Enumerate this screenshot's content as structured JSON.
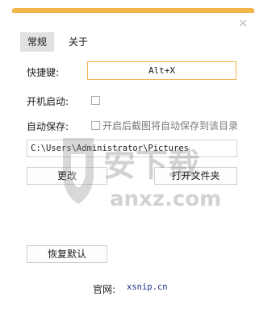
{
  "window": {
    "close_glyph": "×"
  },
  "tabs": {
    "general": "常规",
    "about": "关于"
  },
  "hotkey": {
    "label": "快捷键:",
    "value": "Alt+X"
  },
  "autostart": {
    "label": "开机启动:"
  },
  "autosave": {
    "label": "自动保存:",
    "option_label": "开启后截图将自动保存到该目录"
  },
  "save_path": {
    "value": "C:\\Users\\Administrator\\Pictures"
  },
  "buttons": {
    "change": "更改",
    "open_folder": "打开文件夹",
    "restore_defaults": "恢复默认"
  },
  "footer": {
    "website_label": "官网:",
    "website_url": "xsnip.cn"
  },
  "watermark": {
    "cn_text": "安下载",
    "en_text": "anxz.com"
  },
  "colors": {
    "accent": "#f0b64a",
    "link": "#1d2f8a"
  }
}
